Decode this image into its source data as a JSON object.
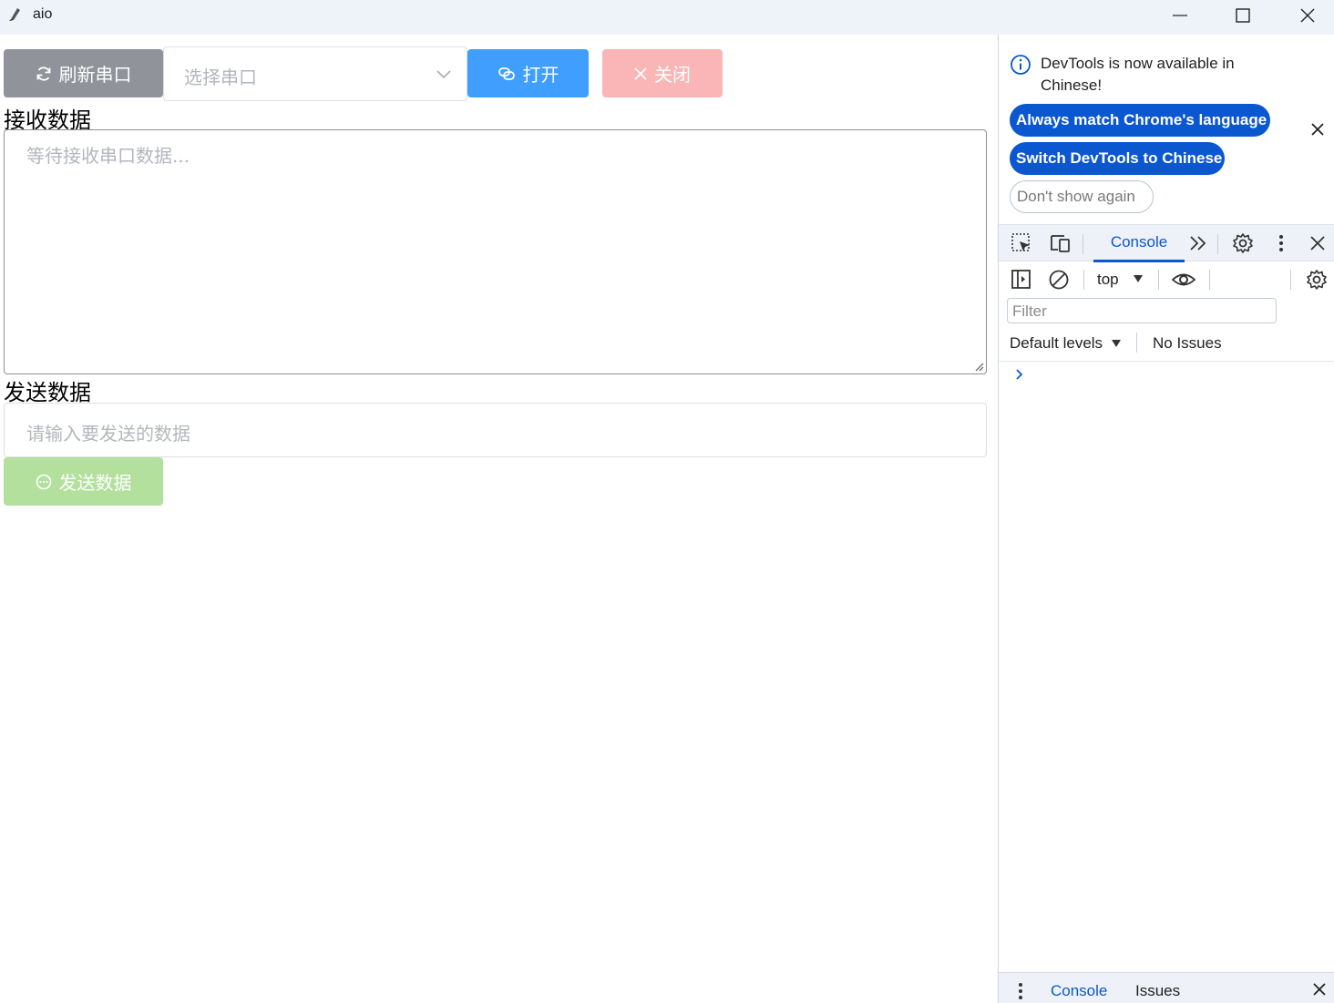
{
  "window": {
    "title": "aio"
  },
  "app": {
    "refresh_label": "刷新串口",
    "port_select_placeholder": "选择串口",
    "open_label": "打开",
    "close_label": "关闭",
    "receive_label": "接收数据",
    "receive_placeholder": "等待接收串口数据...",
    "send_label": "发送数据",
    "send_placeholder": "请输入要发送的数据",
    "send_button_label": "发送数据",
    "colors": {
      "refresh": "#909399",
      "open": "#409eff",
      "close_disabled": "#fab6b6",
      "send_disabled": "#b3e19d"
    }
  },
  "devtools": {
    "infobar": {
      "message": "DevTools is now available in Chinese!",
      "match_language_label": "Always match Chrome's language",
      "switch_label": "Switch DevTools to Chinese",
      "dont_show_label": "Don't show again"
    },
    "tabs": {
      "console": "Console"
    },
    "console": {
      "context": "top",
      "filter_placeholder": "Filter",
      "levels": "Default levels",
      "issues": "No Issues"
    },
    "drawer": {
      "console": "Console",
      "issues": "Issues"
    },
    "accent": "#0b57d0"
  }
}
